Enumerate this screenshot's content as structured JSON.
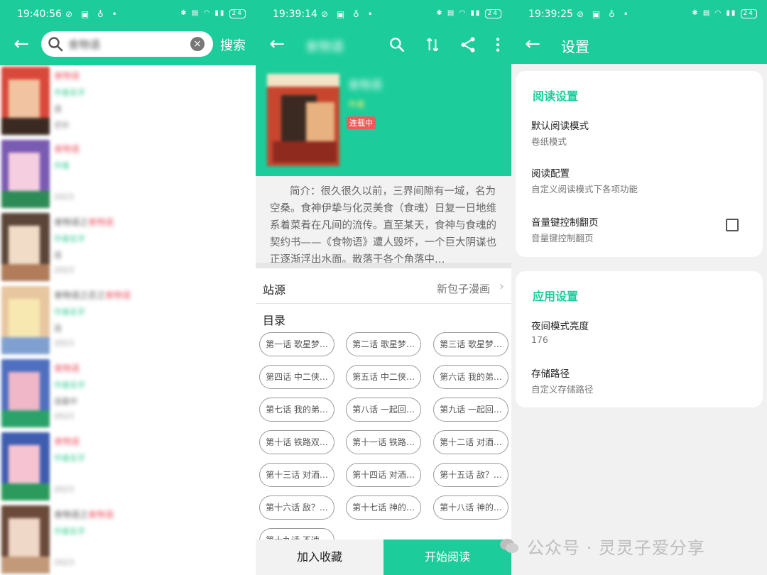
{
  "colors": {
    "accent": "#1ccd9b",
    "badge": "#f05a5a"
  },
  "panel1": {
    "status": {
      "time": "19:40:56",
      "battery": "24"
    },
    "search": {
      "query": "食物语"
    },
    "search_button": "搜索",
    "results": [
      {
        "title": "食物语",
        "title_prefix": "",
        "author": "作者名字",
        "status": "连",
        "update": "更新"
      },
      {
        "title": "食物语",
        "title_prefix": "",
        "author": "作者",
        "status": "",
        "update": "2023"
      },
      {
        "title": "食物语",
        "title_prefix": "食物语之",
        "author": "作者名字",
        "status": "连",
        "update": "2023"
      },
      {
        "title": "食物语",
        "title_prefix": "食物语之恋之",
        "author": "作者名字",
        "status": "连",
        "update": "2023"
      },
      {
        "title": "食物语",
        "title_prefix": "",
        "author": "作者名字",
        "status": "连载中",
        "update": "2023"
      },
      {
        "title": "食物语",
        "title_prefix": "",
        "author": "作者名字",
        "status": "",
        "update": "2023"
      },
      {
        "title": "食物语",
        "title_prefix": "食物语之",
        "author": "作者名字",
        "status": "",
        "update": "2023"
      }
    ]
  },
  "panel2": {
    "status": {
      "time": "19:39:14",
      "battery": "24"
    },
    "title": "食物语",
    "comic": {
      "name": "食物语",
      "author": "作者",
      "status_badge": "连载中"
    },
    "summary": "简介：很久很久以前，三界间隙有一域，名为空桑。食神伊挚与化灵美食（食魂）日复一日地维系着菜肴在凡间的流传。直至某天，食神与食魂的契约书——《食物语》遭人毁坏，一个巨大阴谋也正逐渐浮出水面。散落于各个角落中…",
    "source_label": "站源",
    "source_value": "新包子漫画",
    "toc_label": "目录",
    "chapters": [
      "第一话 歌星梦…",
      "第二话 歌星梦…",
      "第三话 歌星梦…",
      "第四话 中二侠…",
      "第五话 中二侠…",
      "第六话 我的弟…",
      "第七话 我的弟…",
      "第八话 一起回…",
      "第九话 一起回…",
      "第十话 铁路双…",
      "第十一话 铁路…",
      "第十二话 对酒…",
      "第十三话 对酒…",
      "第十四话 对酒…",
      "第十五话 敌？…",
      "第十六话 敌？…",
      "第十七话 神的…",
      "第十八话 神的…",
      "第十九话 不速…"
    ],
    "favorite_button": "加入收藏",
    "read_button": "开始阅读"
  },
  "panel3": {
    "status": {
      "time": "19:39:25",
      "battery": "24"
    },
    "title": "设置",
    "reading": {
      "heading": "阅读设置",
      "items": [
        {
          "name": "默认阅读模式",
          "desc": "卷纸模式"
        },
        {
          "name": "阅读配置",
          "desc": "自定义阅读模式下各项功能"
        },
        {
          "name": "音量键控制翻页",
          "desc": "音量键控制翻页",
          "checked": false
        }
      ]
    },
    "app": {
      "heading": "应用设置",
      "items": [
        {
          "name": "夜间模式亮度",
          "desc": "176"
        },
        {
          "name": "存储路径",
          "desc": "自定义存储路径"
        }
      ]
    }
  },
  "watermark": "公众号 · 灵灵子爱分享"
}
